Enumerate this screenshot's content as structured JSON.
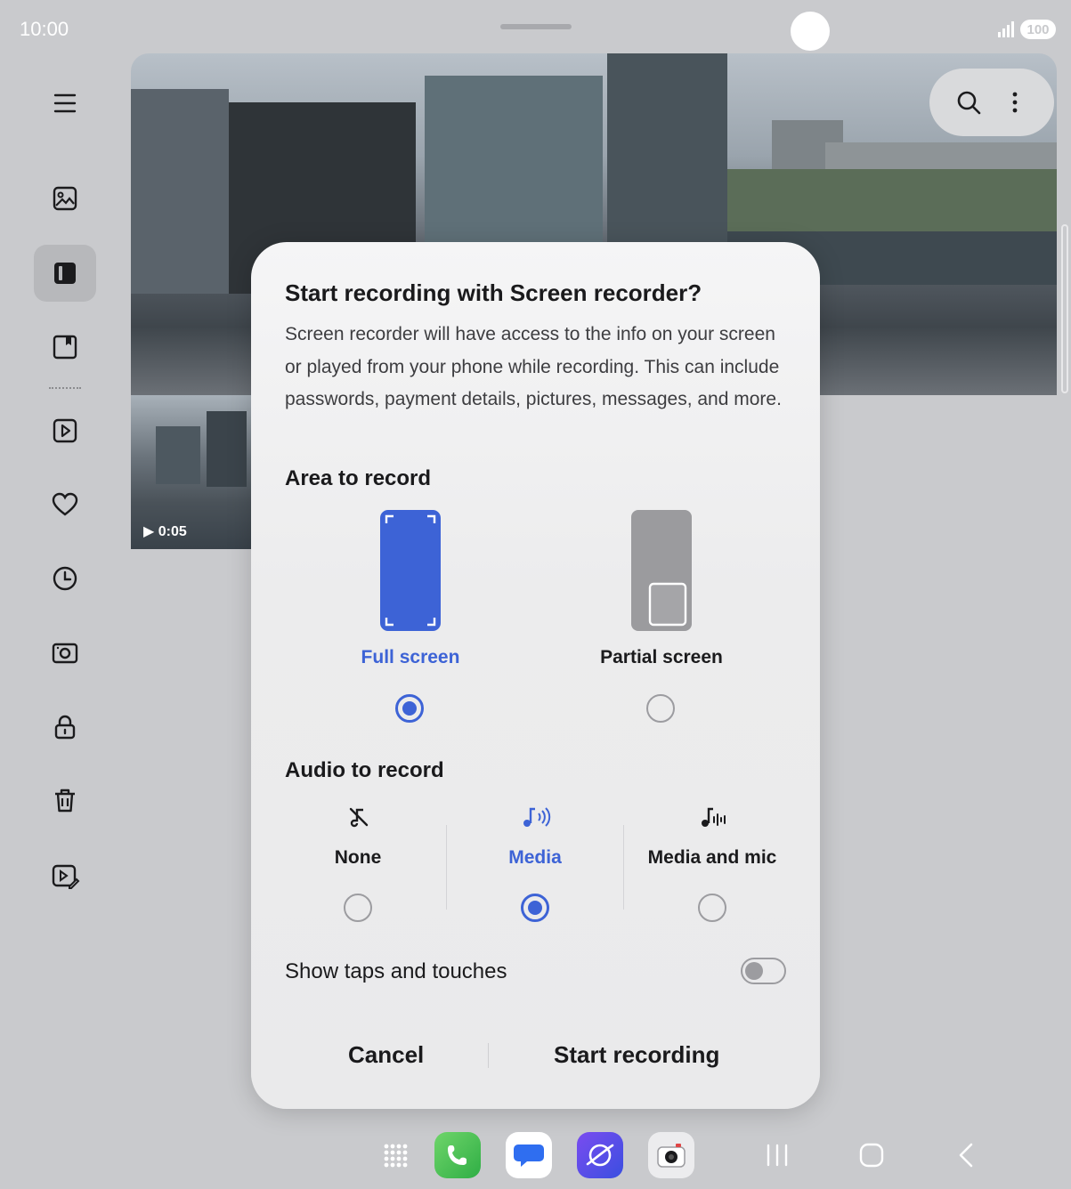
{
  "status_bar": {
    "time": "10:00",
    "battery": "100"
  },
  "sidebar": {
    "items": [
      {
        "name": "menu"
      },
      {
        "name": "pictures"
      },
      {
        "name": "albums",
        "active": true
      },
      {
        "name": "stories"
      },
      {
        "name": "videos"
      },
      {
        "name": "favorites"
      },
      {
        "name": "recent"
      },
      {
        "name": "screenshots"
      },
      {
        "name": "secure-folder"
      },
      {
        "name": "recycle-bin"
      },
      {
        "name": "video-editor"
      }
    ]
  },
  "gallery": {
    "thumb_duration": "0:05"
  },
  "dialog": {
    "title": "Start recording with Screen recorder?",
    "body": "Screen recorder will have access to the info on your screen or played from your phone while recording. This can include passwords, payment details, pictures, messages, and more.",
    "area_heading": "Area to record",
    "area_options": [
      {
        "label": "Full screen",
        "selected": true
      },
      {
        "label": "Partial screen",
        "selected": false
      }
    ],
    "audio_heading": "Audio to record",
    "audio_options": [
      {
        "label": "None",
        "icon": "music-off-icon",
        "selected": false
      },
      {
        "label": "Media",
        "icon": "music-sound-icon",
        "selected": true
      },
      {
        "label": "Media and mic",
        "icon": "music-mic-icon",
        "selected": false
      }
    ],
    "show_taps_label": "Show taps and touches",
    "show_taps_enabled": false,
    "cancel_label": "Cancel",
    "start_label": "Start recording"
  },
  "colors": {
    "accent": "#3d63d6",
    "dialog_bg": "#efeff0",
    "page_bg": "#c9cacd"
  },
  "dock": [
    "apps-grid-icon",
    "phone-icon",
    "messages-icon",
    "internet-icon",
    "camera-icon"
  ],
  "nav": [
    "recents-icon",
    "home-icon",
    "back-icon"
  ]
}
